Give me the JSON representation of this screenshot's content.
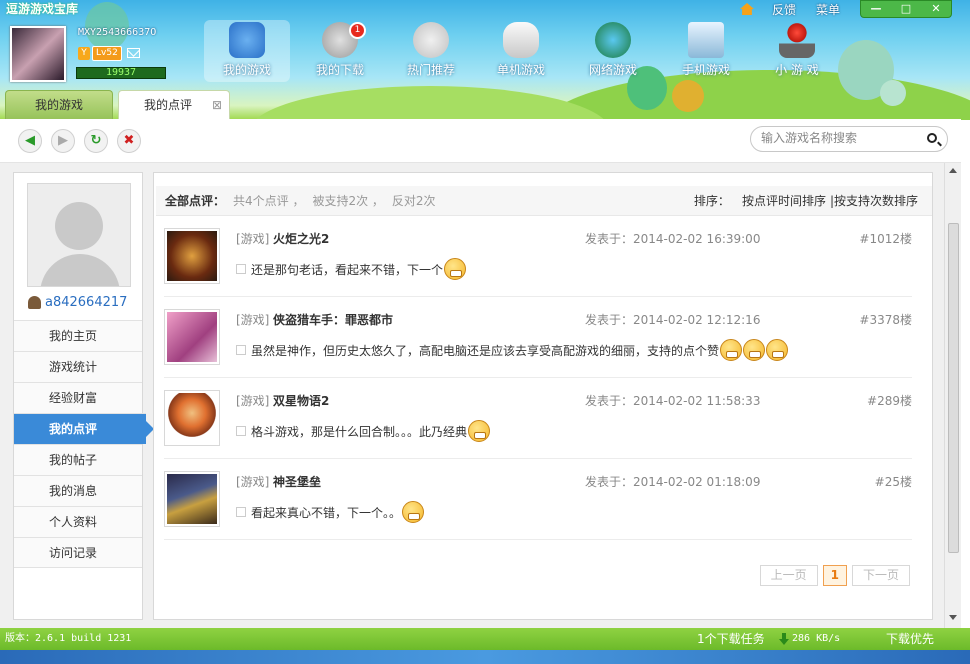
{
  "app": {
    "title": "逗游游戏宝库"
  },
  "user": {
    "id": "MXY254366637O",
    "level": "Lv52",
    "badge": "Y",
    "exp": "19937",
    "name": "a842664217"
  },
  "top_links": {
    "feedback": "反馈",
    "menu": "菜单"
  },
  "window": {
    "min": "—",
    "max": "□",
    "close": "✕"
  },
  "nav": [
    {
      "label": "我的游戏"
    },
    {
      "label": "我的下载",
      "badge": "1"
    },
    {
      "label": "热门推荐"
    },
    {
      "label": "单机游戏"
    },
    {
      "label": "网络游戏"
    },
    {
      "label": "手机游戏"
    },
    {
      "label": "小 游 戏"
    }
  ],
  "tabs": {
    "mygames": "我的游戏",
    "reviews": "我的点评",
    "close": "⊠"
  },
  "toolbar": {
    "back": "◀",
    "forward": "▶",
    "refresh": "↻",
    "stop": "✖"
  },
  "search": {
    "placeholder": "输入游戏名称搜索"
  },
  "sidebar": {
    "items": [
      {
        "label": "我的主页"
      },
      {
        "label": "游戏统计"
      },
      {
        "label": "经验财富"
      },
      {
        "label": "我的点评"
      },
      {
        "label": "我的帖子"
      },
      {
        "label": "我的消息"
      },
      {
        "label": "个人资料"
      },
      {
        "label": "访问记录"
      }
    ]
  },
  "summary": {
    "label": "全部点评：",
    "total": "共4个点评 ，",
    "supported": "被支持2次 ，",
    "opposed": "反对2次",
    "sort_label": "排序：",
    "sort_time": "按点评时间排序",
    "sort_support": "|按支持次数排序"
  },
  "reviews": [
    {
      "type": "[游戏]",
      "title": "火炬之光2",
      "date": "发表于：2014-02-02 16:39:00",
      "floor": "#1012楼",
      "body": "还是那句老话，看起来不错，下一个",
      "emojis": 1
    },
    {
      "type": "[游戏]",
      "title": "侠盗猎车手：罪恶都市",
      "date": "发表于：2014-02-02 12:12:16",
      "floor": "#3378楼",
      "body": "虽然是神作，但历史太悠久了，高配电脑还是应该去享受高配游戏的细丽，支持的点个赞",
      "emojis": 3
    },
    {
      "type": "[游戏]",
      "title": "双星物语2",
      "date": "发表于：2014-02-02 11:58:33",
      "floor": "#289楼",
      "body": "格斗游戏，那是什么回合制。。。此乃经典",
      "emojis": 1
    },
    {
      "type": "[游戏]",
      "title": "神圣堡垒",
      "date": "发表于：2014-02-02 01:18:09",
      "floor": "#25楼",
      "body": "看起来真心不错，下一个。。",
      "emojis": 1
    }
  ],
  "pager": {
    "prev": "上一页",
    "current": "1",
    "next": "下一页"
  },
  "status": {
    "version": "版本：2.6.1 build 1231",
    "tasks": "1个下载任务",
    "speed": "286 KB/s",
    "priority": "下载优先"
  }
}
